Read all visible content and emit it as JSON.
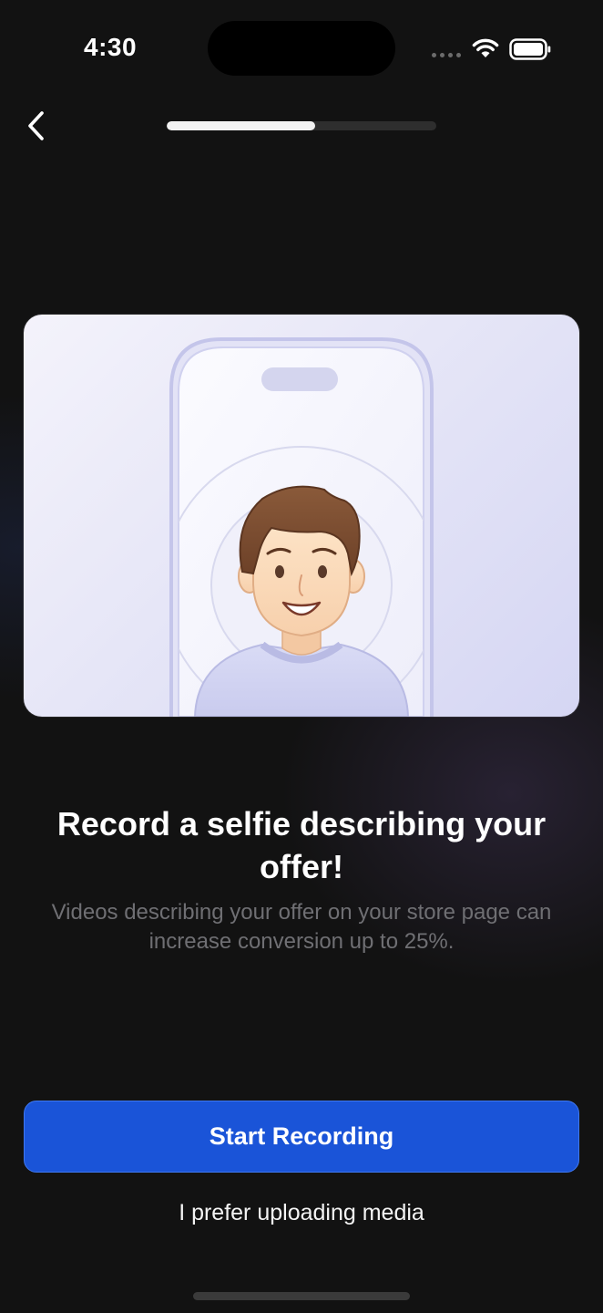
{
  "status_bar": {
    "time": "4:30",
    "icons": [
      "signal-dots-icon",
      "wifi-icon",
      "battery-icon"
    ]
  },
  "nav": {
    "back_icon": "chevron-left-icon",
    "progress_fraction": 0.55
  },
  "illustration": {
    "subject": "smiling-person-selfie-in-phone"
  },
  "content": {
    "headline": "Record a selfie describing your offer!",
    "subtext": "Videos describing your offer on your store page can increase conversion up to 25%."
  },
  "actions": {
    "primary_label": "Start Recording",
    "secondary_label": "I prefer uploading media"
  },
  "colors": {
    "background": "#121212",
    "primary_button": "#1a54d8",
    "progress_fill": "#f2f2f2",
    "progress_track": "#2e2e2e",
    "subtext": "#6f6f73"
  }
}
